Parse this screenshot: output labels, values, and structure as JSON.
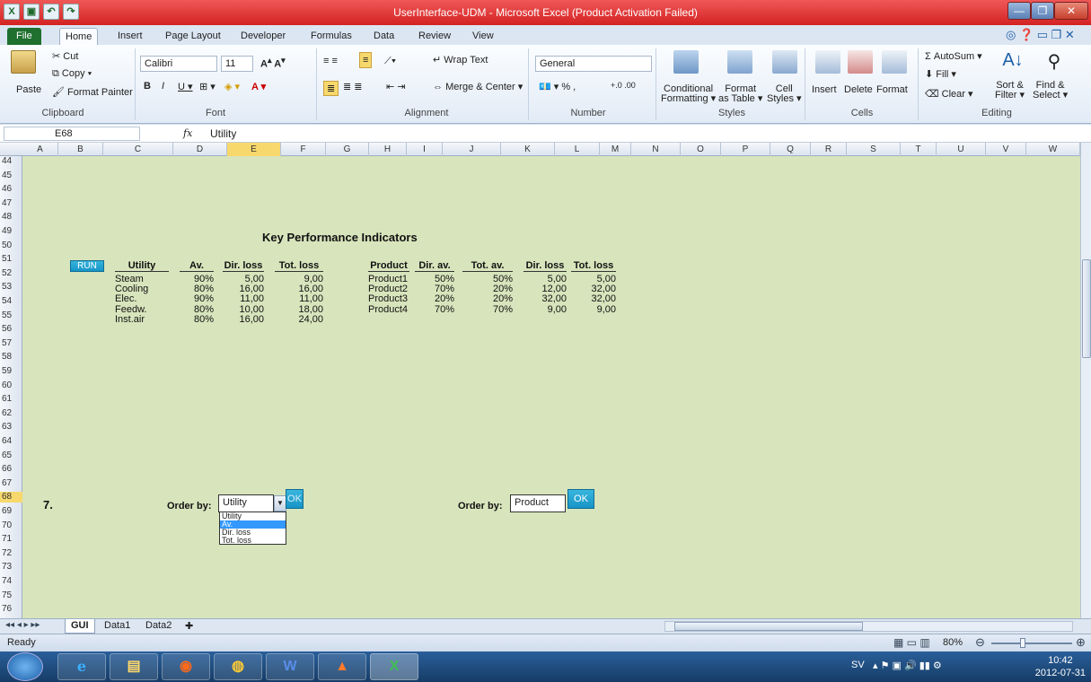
{
  "window": {
    "title": "UserInterface-UDM  -  Microsoft Excel (Product Activation Failed)"
  },
  "ribbon": {
    "tabs": [
      "File",
      "Home",
      "Insert",
      "Page Layout",
      "Developer",
      "Formulas",
      "Data",
      "Review",
      "View"
    ],
    "active_tab": "Home",
    "clipboard": {
      "paste": "Paste",
      "cut": "Cut",
      "copy": "Copy",
      "format_painter": "Format Painter",
      "label": "Clipboard"
    },
    "font": {
      "name": "Calibri",
      "size": "11",
      "label": "Font"
    },
    "alignment": {
      "wrap_text": "Wrap Text",
      "merge_center": "Merge & Center",
      "label": "Alignment"
    },
    "number": {
      "format": "General",
      "label": "Number"
    },
    "styles": {
      "conditional": "Conditional",
      "conditional2": "Formatting",
      "format_table": "Format",
      "format_table2": "as Table",
      "cell_styles": "Cell",
      "cell_styles2": "Styles",
      "label": "Styles"
    },
    "cells": {
      "insert": "Insert",
      "delete": "Delete",
      "format": "Format",
      "label": "Cells"
    },
    "editing": {
      "autosum": "AutoSum",
      "fill": "Fill",
      "clear": "Clear",
      "sort": "Sort &",
      "sort2": "Filter",
      "find": "Find &",
      "find2": "Select",
      "label": "Editing"
    }
  },
  "formula_bar": {
    "name_box": "E68",
    "fx": "fx",
    "value": "Utility"
  },
  "columns": [
    "A",
    "B",
    "C",
    "D",
    "E",
    "F",
    "G",
    "H",
    "I",
    "J",
    "K",
    "L",
    "M",
    "N",
    "O",
    "P",
    "Q",
    "R",
    "S",
    "T",
    "U",
    "V",
    "W"
  ],
  "rows": [
    "44",
    "45",
    "46",
    "47",
    "48",
    "49",
    "50",
    "51",
    "52",
    "53",
    "54",
    "55",
    "56",
    "57",
    "58",
    "59",
    "60",
    "61",
    "62",
    "63",
    "64",
    "65",
    "66",
    "67",
    "68",
    "69",
    "70",
    "71",
    "72",
    "73",
    "74",
    "75",
    "76"
  ],
  "sheet": {
    "title": "Key Performance Indicators",
    "run_label": "RUN",
    "section_number": "7.",
    "utility_table": {
      "headers": [
        "Utility",
        "Av.",
        "Dir. loss",
        "Tot. loss"
      ],
      "rows": [
        [
          "Steam",
          "90%",
          "5,00",
          "9,00"
        ],
        [
          "Cooling",
          "80%",
          "16,00",
          "16,00"
        ],
        [
          "Elec.",
          "90%",
          "11,00",
          "11,00"
        ],
        [
          "Feedw.",
          "80%",
          "10,00",
          "18,00"
        ],
        [
          "Inst.air",
          "80%",
          "16,00",
          "24,00"
        ]
      ]
    },
    "product_table": {
      "headers": [
        "Product",
        "Dir. av.",
        "Tot. av.",
        "Dir. loss",
        "Tot. loss"
      ],
      "rows": [
        [
          "Product1",
          "50%",
          "50%",
          "5,00",
          "5,00"
        ],
        [
          "Product2",
          "70%",
          "20%",
          "12,00",
          "32,00"
        ],
        [
          "Product3",
          "20%",
          "20%",
          "32,00",
          "32,00"
        ],
        [
          "Product4",
          "70%",
          "70%",
          "9,00",
          "9,00"
        ]
      ]
    },
    "order_left": {
      "label": "Order by:",
      "value": "Utility",
      "ok": "OK",
      "options": [
        "Utility",
        "Av.",
        "Dir. loss",
        "Tot. loss"
      ],
      "highlighted": "Av."
    },
    "order_right": {
      "label": "Order by:",
      "value": "Product",
      "ok": "OK"
    }
  },
  "sheet_tabs": [
    "GUI",
    "Data1",
    "Data2"
  ],
  "status": {
    "ready": "Ready",
    "zoom": "80%"
  },
  "taskbar": {
    "lang": "SV",
    "time": "10:42",
    "date": "2012-07-31"
  }
}
